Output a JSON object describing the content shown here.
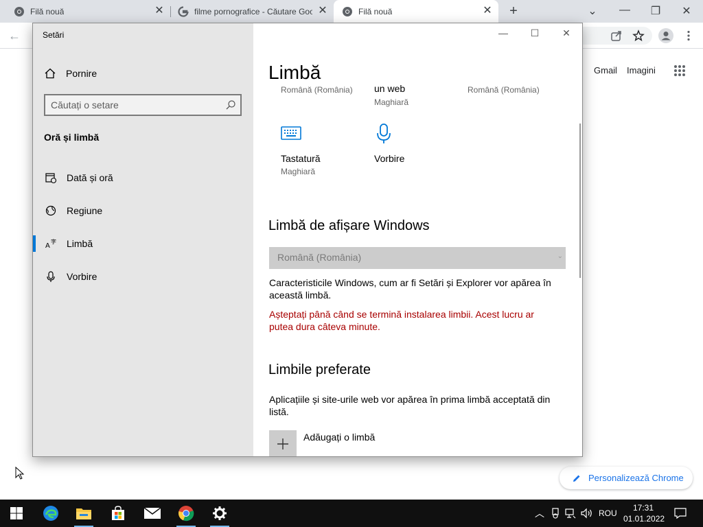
{
  "browser": {
    "tabs": [
      {
        "title": "Filă nouă",
        "icon": "chrome-icon"
      },
      {
        "title": "filme pornografice - Căutare Google",
        "icon": "google-icon"
      },
      {
        "title": "Filă nouă",
        "icon": "chrome-icon",
        "active": true
      }
    ],
    "google_links": {
      "gmail": "Gmail",
      "images": "Imagini"
    },
    "customize_label": "Personalizează Chrome"
  },
  "settings": {
    "app_title": "Setări",
    "home_label": "Pornire",
    "search_placeholder": "Căutați o setare",
    "section_title": "Oră și limbă",
    "nav": [
      {
        "label": "Dată și oră",
        "icon": "date-time-icon"
      },
      {
        "label": "Regiune",
        "icon": "region-globe-icon"
      },
      {
        "label": "Limbă",
        "icon": "language-icon",
        "selected": true
      },
      {
        "label": "Vorbire",
        "icon": "microphone-icon"
      }
    ],
    "page_title": "Limbă",
    "cut_row": {
      "left": "Română (România)",
      "middle": "un web",
      "middle_sub": "Maghiară",
      "right": "Română (România)"
    },
    "tiles": [
      {
        "name": "Tastatură",
        "sub": "Maghiară",
        "icon": "keyboard-icon"
      },
      {
        "name": "Vorbire",
        "sub": "",
        "icon": "microphone-icon"
      }
    ],
    "display_language": {
      "heading": "Limbă de afișare Windows",
      "selected": "Română (România)",
      "description": "Caracteristicile Windows, cum ar fi Setări și Explorer vor apărea în această limbă.",
      "warning": "Așteptați până când se termină instalarea limbii. Acest lucru ar putea dura câteva minute."
    },
    "preferred": {
      "heading": "Limbile preferate",
      "description": "Aplicațiile și site-urile web vor apărea în prima limbă acceptată din listă.",
      "add_label": "Adăugați o limbă"
    }
  },
  "taskbar": {
    "language": "ROU",
    "time": "17:31",
    "date": "01.01.2022"
  },
  "colors": {
    "accent": "#0078d7",
    "warning": "#a80000",
    "chrome_blue": "#1a73e8"
  }
}
